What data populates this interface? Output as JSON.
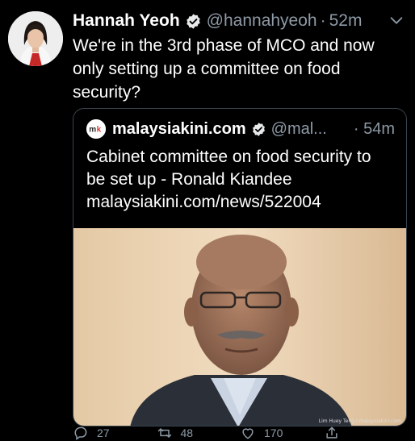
{
  "tweet": {
    "name": "Hannah Yeoh",
    "handle": "@hannahyeoh",
    "separator": "·",
    "time": "52m",
    "text": "We're in the 3rd phase of MCO and now only setting up a committee on food security?"
  },
  "quote": {
    "name": "malaysiakini.com",
    "handle": "@mal...",
    "separator": "·",
    "time": "54m",
    "text_line1": "Cabinet committee on food security to",
    "text_line2": "be set up - Ronald Kiandee",
    "link": "malaysiakini.com/news/522004",
    "photo_credit": "Lim Huey Teng | malaysiakini.com"
  },
  "actions": {
    "replies": "27",
    "retweets": "48",
    "likes": "170"
  },
  "colors": {
    "background": "#000000",
    "muted": "#8e9aa6",
    "border": "#38444d"
  },
  "icons": [
    "verified-badge-icon",
    "chevron-down-icon",
    "reply-icon",
    "retweet-icon",
    "like-icon",
    "share-icon"
  ]
}
